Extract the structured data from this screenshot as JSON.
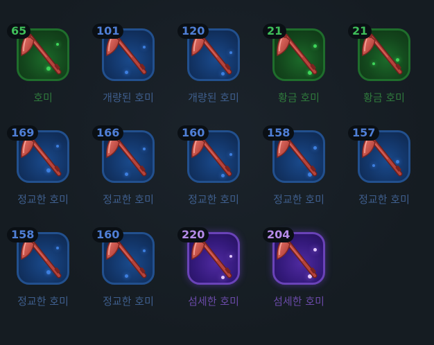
{
  "items": [
    {
      "level": "65",
      "name": "호미",
      "grade": "green"
    },
    {
      "level": "101",
      "name": "개량된 호미",
      "grade": "blue"
    },
    {
      "level": "120",
      "name": "개량된 호미",
      "grade": "blue"
    },
    {
      "level": "21",
      "name": "황금 호미",
      "grade": "green"
    },
    {
      "level": "21",
      "name": "황금 호미",
      "grade": "green"
    },
    {
      "level": "169",
      "name": "정교한 호미",
      "grade": "blue"
    },
    {
      "level": "166",
      "name": "정교한 호미",
      "grade": "blue"
    },
    {
      "level": "160",
      "name": "정교한 호미",
      "grade": "blue"
    },
    {
      "level": "158",
      "name": "정교한 호미",
      "grade": "blue"
    },
    {
      "level": "157",
      "name": "정교한 호미",
      "grade": "blue"
    },
    {
      "level": "158",
      "name": "정교한 호미",
      "grade": "blue"
    },
    {
      "level": "160",
      "name": "정교한 호미",
      "grade": "blue"
    },
    {
      "level": "220",
      "name": "섬세한 호미",
      "grade": "purple"
    },
    {
      "level": "204",
      "name": "섬세한 호미",
      "grade": "purple"
    }
  ],
  "grade_colors": {
    "green": "#1f6e2c",
    "blue": "#22508e",
    "purple": "#6a43b8"
  },
  "item_icon": "hoe-icon"
}
